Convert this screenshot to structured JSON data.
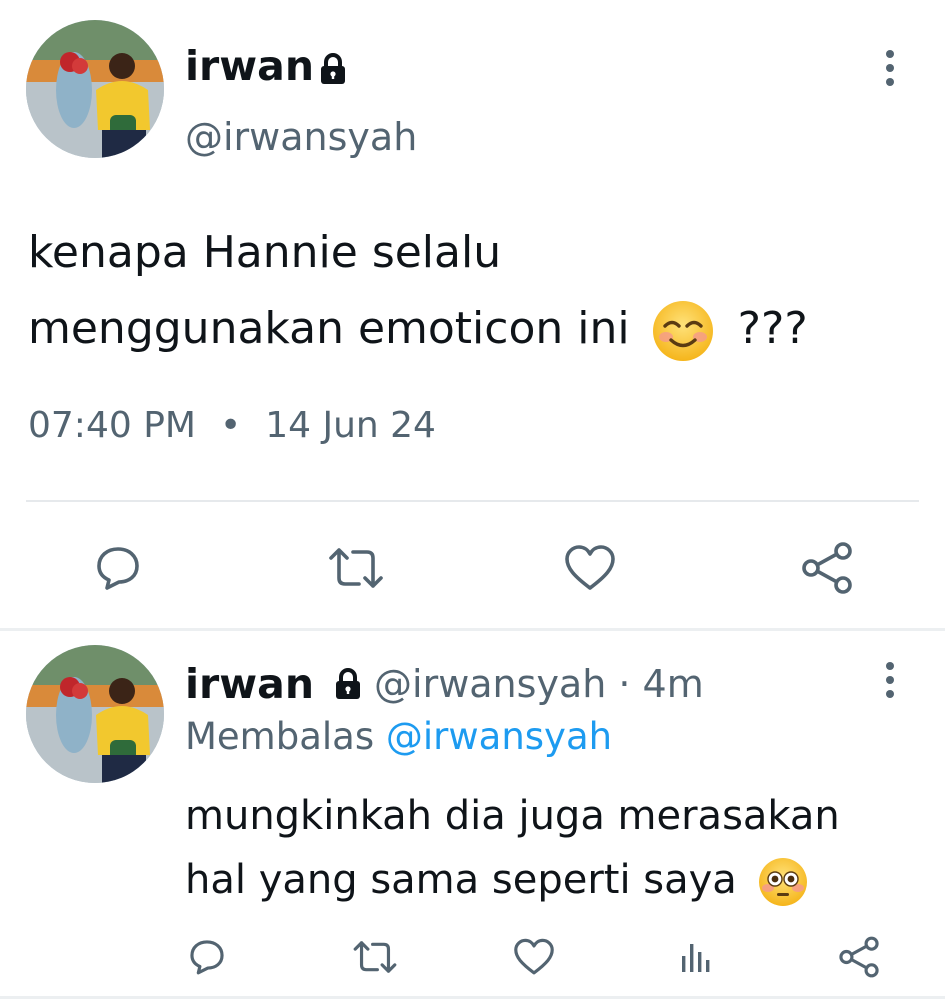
{
  "tweet": {
    "display_name": "irwan",
    "handle": "@irwansyah",
    "text_line1": "kenapa Hannie selalu",
    "text_line2_pre": "menggunakan emoticon ini",
    "text_line2_post": "???",
    "time": "07:40 PM",
    "separator": "•",
    "date": "14 Jun 24"
  },
  "reply": {
    "display_name": "irwan",
    "handle_time": "@irwansyah · 4m",
    "replying_label": "Membalas",
    "replying_to": "@irwansyah",
    "text_line1": "mungkinkah dia juga merasakan",
    "text_line2": "hal yang sama seperti saya"
  },
  "colors": {
    "text": "#0f1419",
    "secondary": "#536471",
    "accent": "#1d9bf0",
    "divider": "#e6e9ec"
  },
  "icons": [
    "lock-icon",
    "more-icon",
    "reply-icon",
    "retweet-icon",
    "like-icon",
    "share-icon",
    "analytics-icon",
    "smiling-emoji",
    "flushed-emoji"
  ]
}
